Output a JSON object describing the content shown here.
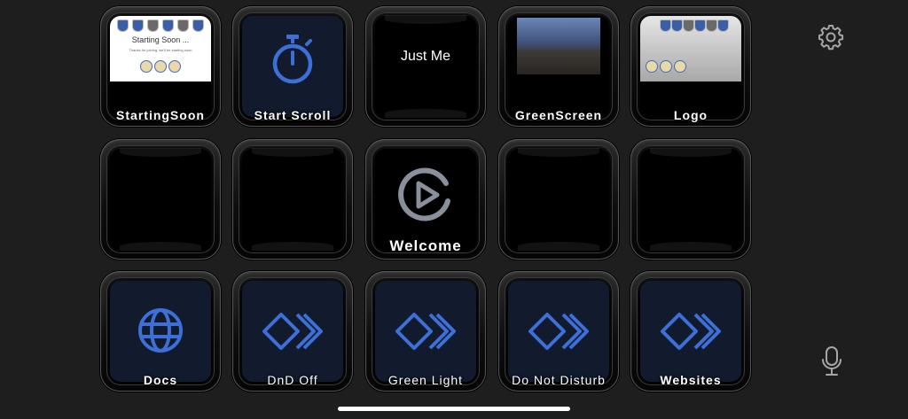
{
  "keys": {
    "starting_soon": {
      "label": "StartingSoon",
      "thumb_title": "Starting Soon ...",
      "thumb_sub": "Thanks for joining, we'll be starting soon"
    },
    "start_scroll": {
      "label": "Start Scroll",
      "icon": "stopwatch-icon"
    },
    "just_me": {
      "text": "Just Me"
    },
    "green_screen": {
      "label": "GreenScreen"
    },
    "logo": {
      "label": "Logo"
    },
    "welcome": {
      "label": "Welcome",
      "icon": "elgato-logo-icon"
    },
    "docs": {
      "label": "Docs",
      "icon": "globe-icon"
    },
    "dnd_off": {
      "label": "DnD Off",
      "icon": "multi-action-icon"
    },
    "green_light": {
      "label": "Green Light",
      "icon": "multi-action-icon"
    },
    "do_not_disturb": {
      "label": "Do Not Disturb",
      "icon": "multi-action-icon"
    },
    "websites": {
      "label": "Websites",
      "icon": "multi-action-icon"
    }
  },
  "side": {
    "settings_icon": "gear-icon",
    "mic_icon": "microphone-icon"
  },
  "colors": {
    "accent_blue": "#3d6fd6",
    "key_navy": "#111b2d",
    "background": "#1e1e1e"
  }
}
